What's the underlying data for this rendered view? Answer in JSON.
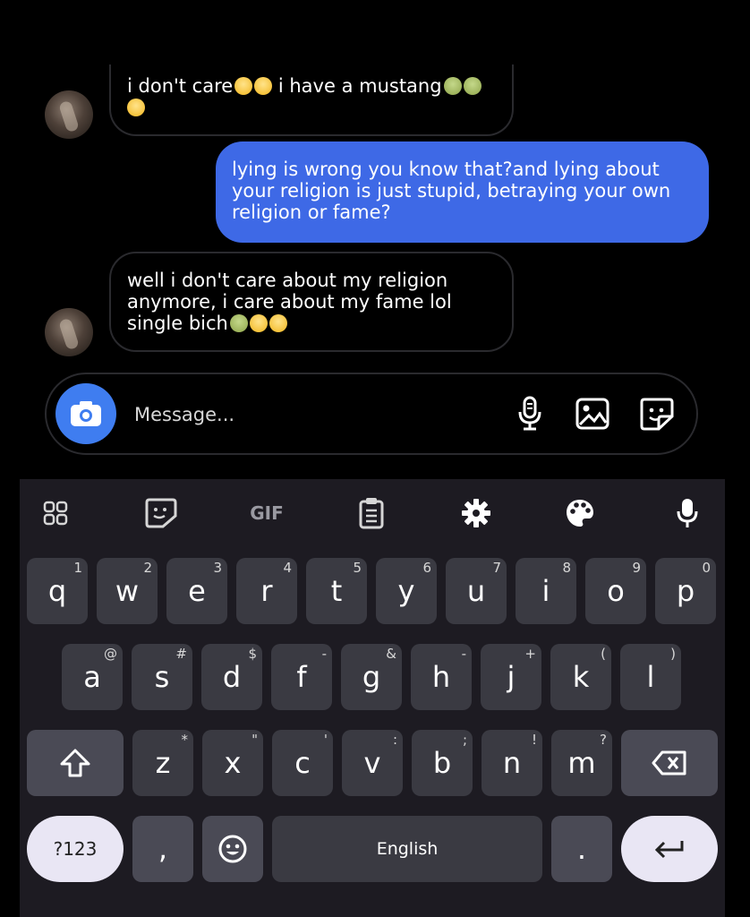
{
  "chat": {
    "messages": [
      {
        "direction": "incoming",
        "text_a": "i don't care",
        "text_b": " i have a mustang"
      },
      {
        "direction": "outgoing",
        "lines": [
          "lying is wrong you know that?and lying about",
          "your religion is just stupid, betraying your own",
          "religion or fame?"
        ]
      },
      {
        "direction": "incoming",
        "lines": [
          "well i don't care about my religion",
          "anymore, i care about my fame lol"
        ],
        "last_line": "single bich"
      }
    ]
  },
  "composer": {
    "placeholder": "Message..."
  },
  "keyboard": {
    "toolbar_gif": "GIF",
    "row1": [
      {
        "k": "q",
        "h": "1"
      },
      {
        "k": "w",
        "h": "2"
      },
      {
        "k": "e",
        "h": "3"
      },
      {
        "k": "r",
        "h": "4"
      },
      {
        "k": "t",
        "h": "5"
      },
      {
        "k": "y",
        "h": "6"
      },
      {
        "k": "u",
        "h": "7"
      },
      {
        "k": "i",
        "h": "8"
      },
      {
        "k": "o",
        "h": "9"
      },
      {
        "k": "p",
        "h": "0"
      }
    ],
    "row2": [
      {
        "k": "a",
        "h": "@"
      },
      {
        "k": "s",
        "h": "#"
      },
      {
        "k": "d",
        "h": "$"
      },
      {
        "k": "f",
        "h": "-"
      },
      {
        "k": "g",
        "h": "&"
      },
      {
        "k": "h",
        "h": "-"
      },
      {
        "k": "j",
        "h": "+"
      },
      {
        "k": "k",
        "h": "("
      },
      {
        "k": "l",
        "h": ")"
      }
    ],
    "row3": [
      {
        "k": "z",
        "h": "*"
      },
      {
        "k": "x",
        "h": "\""
      },
      {
        "k": "c",
        "h": "'"
      },
      {
        "k": "v",
        "h": ":"
      },
      {
        "k": "b",
        "h": ";"
      },
      {
        "k": "n",
        "h": "!"
      },
      {
        "k": "m",
        "h": "?"
      }
    ],
    "sym_label": "?123",
    "comma": ",",
    "space_label": "English",
    "period": "."
  },
  "colors": {
    "outgoing_bubble": "#3e69e6",
    "camera_button": "#3f7df0",
    "keyboard_bg": "#1d1b22"
  }
}
